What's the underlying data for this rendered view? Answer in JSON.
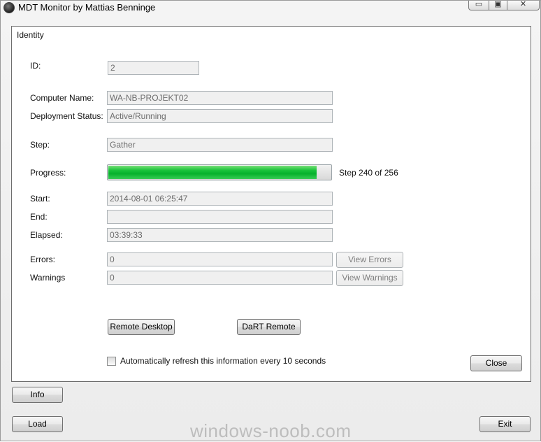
{
  "window": {
    "title": "MDT Monitor by Mattias Benninge"
  },
  "title_controls": {
    "minimize": "▭",
    "maximize": "▣",
    "close": "✕"
  },
  "group": {
    "label": "Identity"
  },
  "fields": {
    "id": {
      "label": "ID:",
      "value": "2"
    },
    "computer_name": {
      "label": "Computer Name:",
      "value": "WA-NB-PROJEKT02"
    },
    "deployment_status": {
      "label": "Deployment Status:",
      "value": "Active/Running"
    },
    "step": {
      "label": "Step:",
      "value": "Gather"
    },
    "progress": {
      "label": "Progress:",
      "text": "Step 240 of 256",
      "current": 240,
      "total": 256
    },
    "start": {
      "label": "Start:",
      "value": "2014-08-01 06:25:47"
    },
    "end": {
      "label": "End:",
      "value": ""
    },
    "elapsed": {
      "label": "Elapsed:",
      "value": "03:39:33"
    },
    "errors": {
      "label": "Errors:",
      "value": "0"
    },
    "warnings": {
      "label": "Warnings",
      "value": "0"
    }
  },
  "buttons": {
    "view_errors": "View Errors",
    "view_warnings": "View Warnings",
    "remote_desktop": "Remote Desktop",
    "dart_remote": "DaRT Remote",
    "close": "Close",
    "info": "Info",
    "load": "Load",
    "exit": "Exit"
  },
  "auto_refresh": {
    "label": "Automatically refresh this information every 10 seconds",
    "checked": false
  },
  "watermark": "windows-noob.com",
  "colors": {
    "progress_green": "#06b12c",
    "panel_border": "#6e6e6e"
  },
  "icons": {
    "app": "webcam-icon"
  }
}
